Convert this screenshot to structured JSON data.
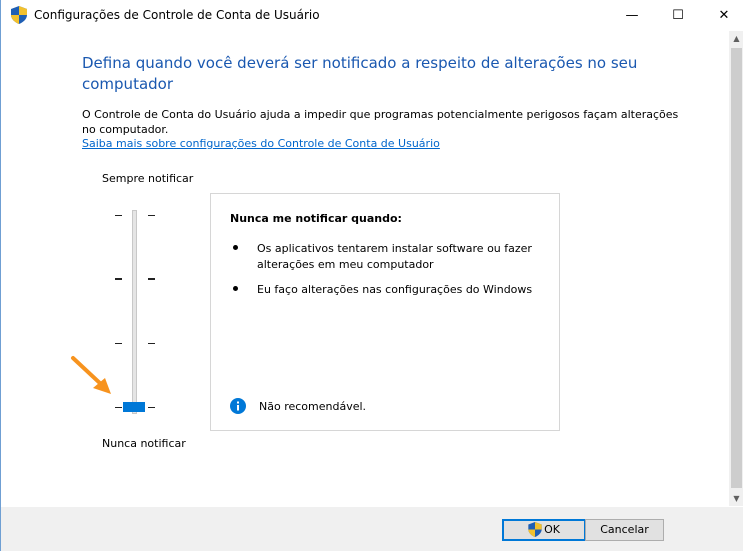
{
  "window": {
    "title": "Configurações de Controle de Conta de Usuário",
    "minimize": "—",
    "maximize": "☐",
    "close": "✕"
  },
  "main": {
    "heading": "Defina quando você deverá ser notificado a respeito de alterações no seu computador",
    "description": "O Controle de Conta do Usuário ajuda a impedir que programas potencialmente perigosos façam alterações no computador.",
    "learn_more_link": "Saiba mais sobre configurações do Controle de Conta de Usuário"
  },
  "slider": {
    "top_label": "Sempre notificar",
    "bottom_label": "Nunca notificar",
    "levels": 4,
    "selected_level": 1
  },
  "info_box": {
    "title": "Nunca me notificar quando:",
    "bullets": [
      "Os aplicativos tentarem instalar software ou fazer alterações em meu computador",
      "Eu faço alterações nas configurações do Windows"
    ],
    "notice": "Não recomendável."
  },
  "buttons": {
    "ok": "OK",
    "cancel": "Cancelar"
  },
  "colors": {
    "heading": "#1a58b0",
    "link": "#0066cc",
    "accent": "#0078d7",
    "arrow": "#f7931e"
  },
  "icons": {
    "title": "uac-shield-icon",
    "notice": "info-icon",
    "ok_button": "uac-shield-icon"
  }
}
